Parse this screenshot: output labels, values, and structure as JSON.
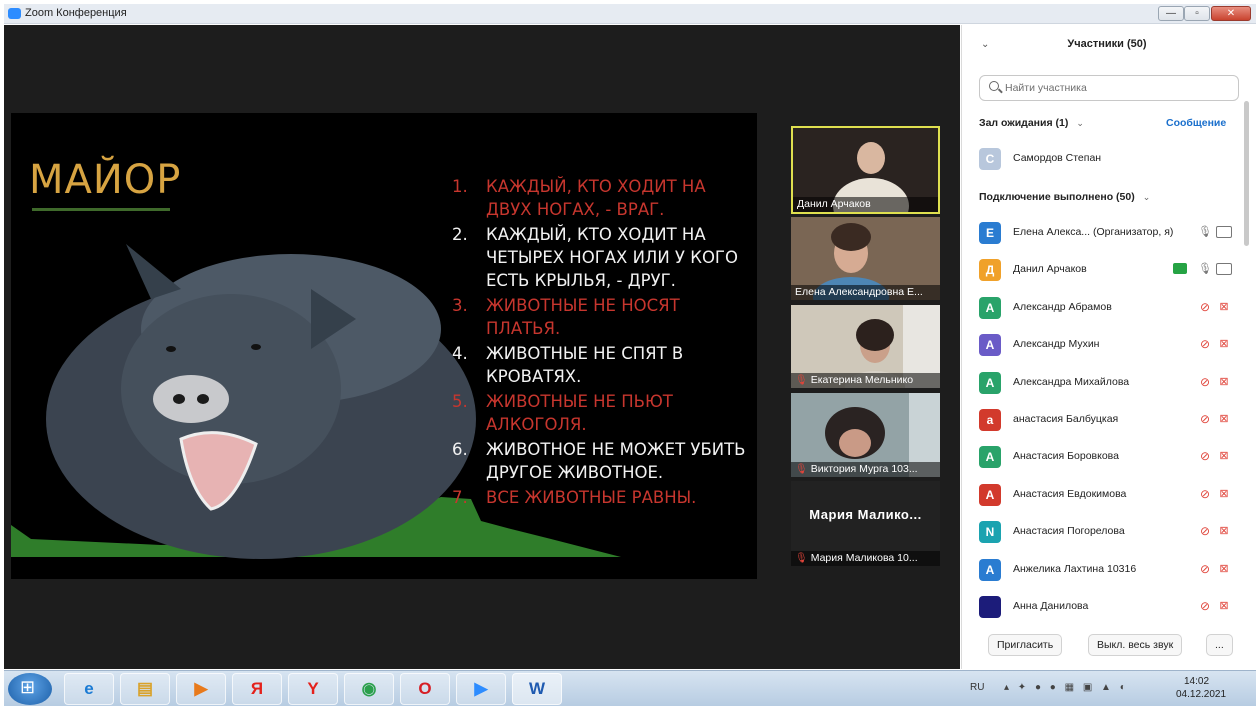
{
  "window": {
    "title": "Zoom Конференция",
    "minimize_glyph": "—",
    "maximize_glyph": "▫",
    "close_glyph": "✕"
  },
  "slide": {
    "title": "МАЙОР",
    "items": [
      {
        "num": "1.",
        "text": "Каждый, кто ходит на двух ногах, - враг.",
        "color": "red"
      },
      {
        "num": "2.",
        "text": "Каждый, кто ходит на четырех ногах или у кого есть крылья, - друг.",
        "color": "white"
      },
      {
        "num": "3.",
        "text": "Животные не носят платья.",
        "color": "red"
      },
      {
        "num": "4.",
        "text": "Животные не спят в кроватях.",
        "color": "white"
      },
      {
        "num": "5.",
        "text": "Животные не пьют алкоголя.",
        "color": "red"
      },
      {
        "num": "6.",
        "text": "Животное не может убить другое животное.",
        "color": "white"
      },
      {
        "num": "7.",
        "text": "Все животные равны.",
        "color": "red"
      }
    ]
  },
  "videos": [
    {
      "name": "Данил Арчаков",
      "muted": false
    },
    {
      "name": "Елена Александровна Е...",
      "muted": false
    },
    {
      "name": "Екатерина Мельнико",
      "muted": true
    },
    {
      "name": "Виктория Мурга 103...",
      "muted": true
    },
    {
      "name": "Мария Маликова 10...",
      "muted": true,
      "display_name": "Мария Малико..."
    }
  ],
  "panel": {
    "title": "Участники (50)",
    "search_placeholder": "Найти участника",
    "waiting_label": "Зал ожидания (1)",
    "message_label": "Сообщение",
    "waiting": [
      {
        "initial": "С",
        "name": "Самордов Степан",
        "color": "#b8c7dc"
      }
    ],
    "connected_label": "Подключение выполнено (50)",
    "participants": [
      {
        "initial": "Е",
        "name": "Елена Алекса... (Организатор, я)",
        "color": "#2a7cd1",
        "audio": "on",
        "video": "off-grey"
      },
      {
        "initial": "Д",
        "name": "Данил Арчаков",
        "color": "#f0a12a",
        "audio": "on",
        "video": "off-grey",
        "sharing": true
      },
      {
        "initial": "А",
        "name": "Александр Абрамов",
        "color": "#29a36a",
        "audio": "muted",
        "video": "muted"
      },
      {
        "initial": "А",
        "name": "Александр Мухин",
        "color": "#6a5bc7",
        "audio": "muted",
        "video": "muted"
      },
      {
        "initial": "А",
        "name": "Александра Михайлова",
        "color": "#29a36a",
        "audio": "muted",
        "video": "muted"
      },
      {
        "initial": "а",
        "name": "анастасия Балбуцкая",
        "color": "#d23a2c",
        "audio": "muted",
        "video": "muted"
      },
      {
        "initial": "А",
        "name": "Анастасия Боровкова",
        "color": "#29a36a",
        "audio": "muted",
        "video": "muted"
      },
      {
        "initial": "А",
        "name": "Анастасия Евдокимова",
        "color": "#d23a2c",
        "audio": "muted",
        "video": "muted"
      },
      {
        "initial": "N",
        "name": "Анастасия Погорелова",
        "color": "#1ba3b0",
        "audio": "muted",
        "video": "muted"
      },
      {
        "initial": "А",
        "name": "Анжелика Лахтина 10316",
        "color": "#2a7cd1",
        "audio": "muted",
        "video": "muted"
      },
      {
        "initial": "",
        "name": "Анна Данилова",
        "color": "#1c1c7a",
        "audio": "muted",
        "video": "muted"
      }
    ],
    "invite_label": "Пригласить",
    "mute_all_label": "Выкл. весь звук",
    "more_label": "..."
  },
  "taskbar": {
    "apps": [
      "ie",
      "explorer",
      "media",
      "Я",
      "Y",
      "chrome",
      "opera",
      "zoom",
      "W"
    ],
    "language": "RU",
    "time": "14:02",
    "date": "04.12.2021"
  }
}
